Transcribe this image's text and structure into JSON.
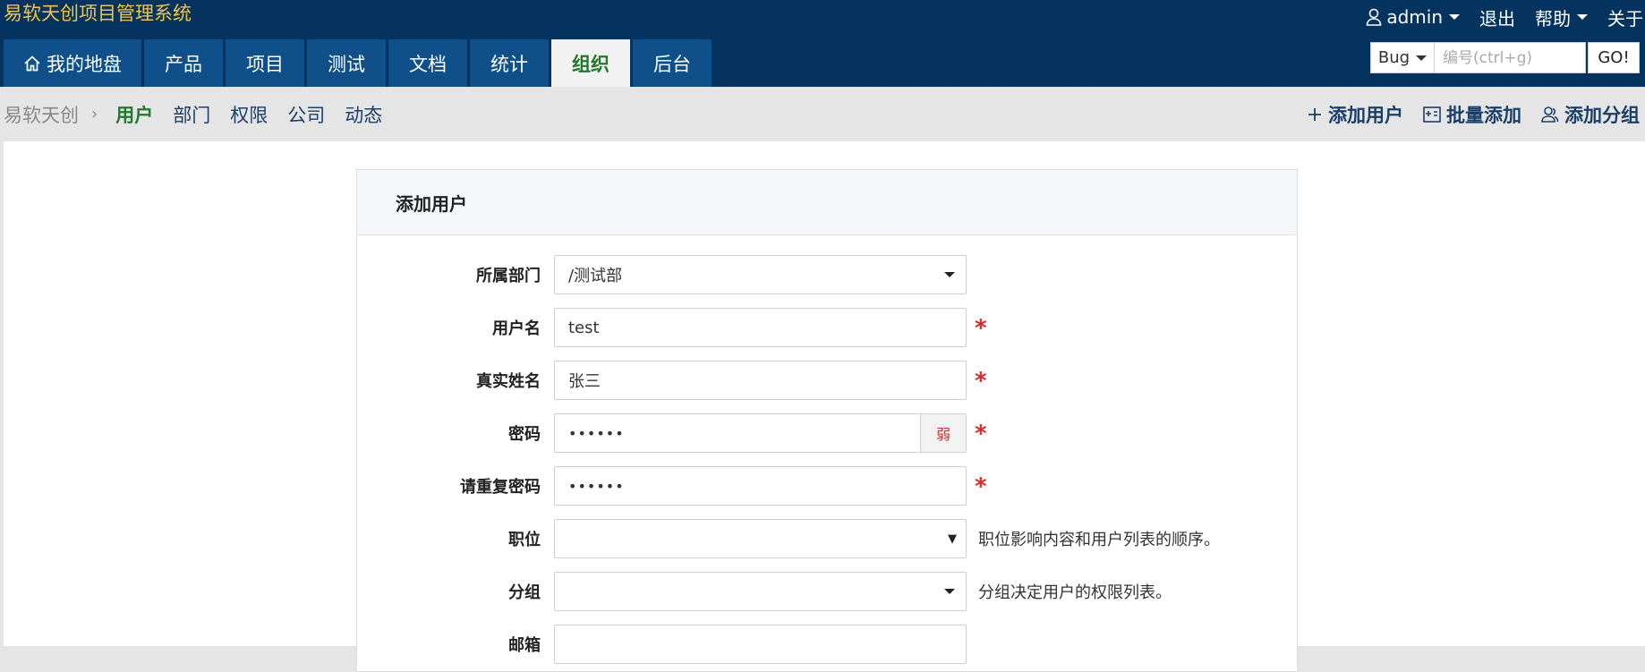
{
  "header": {
    "app_title": "易软天创项目管理系统",
    "user": "admin",
    "logout": "退出",
    "help": "帮助",
    "about": "关于"
  },
  "main_nav": [
    {
      "label": "我的地盘",
      "icon": "home-icon",
      "active": false
    },
    {
      "label": "产品",
      "active": false
    },
    {
      "label": "项目",
      "active": false
    },
    {
      "label": "测试",
      "active": false
    },
    {
      "label": "文档",
      "active": false
    },
    {
      "label": "统计",
      "active": false
    },
    {
      "label": "组织",
      "active": true
    },
    {
      "label": "后台",
      "active": false
    }
  ],
  "search": {
    "type": "Bug",
    "placeholder": "编号(ctrl+g)",
    "go": "GO!"
  },
  "sub_nav": {
    "root": "易软天创",
    "items": [
      {
        "label": "用户",
        "active": true
      },
      {
        "label": "部门",
        "active": false
      },
      {
        "label": "权限",
        "active": false
      },
      {
        "label": "公司",
        "active": false
      },
      {
        "label": "动态",
        "active": false
      }
    ],
    "actions": [
      {
        "label": "添加用户",
        "icon": "plus-icon"
      },
      {
        "label": "批量添加",
        "icon": "batch-add-icon"
      },
      {
        "label": "添加分组",
        "icon": "group-icon"
      }
    ]
  },
  "form": {
    "title": "添加用户",
    "fields": {
      "dept": {
        "label": "所属部门",
        "value": "/测试部"
      },
      "account": {
        "label": "用户名",
        "value": "test",
        "required": "*"
      },
      "realname": {
        "label": "真实姓名",
        "value": "张三",
        "required": "*"
      },
      "password": {
        "label": "密码",
        "value": "••••••",
        "strength": "弱",
        "required": "*"
      },
      "password2": {
        "label": "请重复密码",
        "value": "••••••",
        "required": "*"
      },
      "role": {
        "label": "职位",
        "value": "",
        "hint": "职位影响内容和用户列表的顺序。"
      },
      "group": {
        "label": "分组",
        "value": "",
        "hint": "分组决定用户的权限列表。"
      },
      "email": {
        "label": "邮箱",
        "value": ""
      }
    }
  },
  "colors": {
    "header_bg": "#03335e",
    "nav_tab_bg": "#0f4f8a",
    "active_green": "#22782b",
    "title_yellow": "#f5c542",
    "required_red": "#d62c2c"
  }
}
